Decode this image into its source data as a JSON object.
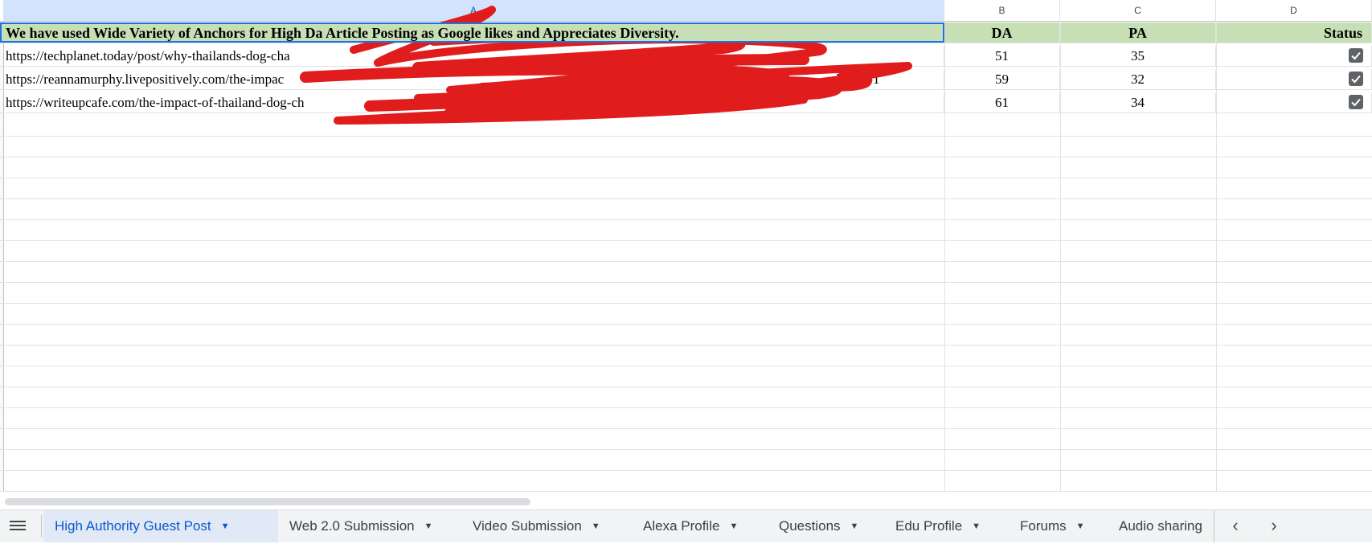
{
  "columns": [
    {
      "letter": "A",
      "selected": true
    },
    {
      "letter": "B",
      "selected": false
    },
    {
      "letter": "C",
      "selected": false
    },
    {
      "letter": "D",
      "selected": false
    }
  ],
  "header_row": {
    "a": "We have used Wide Variety of Anchors for High Da Article Posting as Google likes and Appreciates Diversity.",
    "b": "DA",
    "c": "PA",
    "d": "Status"
  },
  "rows": [
    {
      "url": "https://techplanet.today/post/why-thailands-dog-cha",
      "da": "51",
      "pa": "35",
      "checked": true
    },
    {
      "url": "https://reannamurphy.livepositively.com/the-impac",
      "url_tail": "do/?gs-1",
      "da": "59",
      "pa": "32",
      "checked": true
    },
    {
      "url": "https://writeupcafe.com/the-impact-of-thailand-dog-ch",
      "da": "61",
      "pa": "34",
      "checked": true
    }
  ],
  "redaction_color": "#e01c1c",
  "sheet_tabs": [
    {
      "label": "High Authority Guest Post",
      "active": true
    },
    {
      "label": "Web 2.0 Submission",
      "active": false
    },
    {
      "label": "Video Submission",
      "active": false
    },
    {
      "label": "Alexa Profile",
      "active": false
    },
    {
      "label": "Questions",
      "active": false
    },
    {
      "label": "Edu Profile",
      "active": false
    },
    {
      "label": "Forums",
      "active": false
    },
    {
      "label": "Audio sharing",
      "active": false
    }
  ],
  "icons": {
    "menu": "all-sheets-menu-icon",
    "prev": "chevron-left-icon",
    "next": "chevron-right-icon",
    "caret": "dropdown-caret-icon",
    "check": "checkbox-checked-icon"
  }
}
